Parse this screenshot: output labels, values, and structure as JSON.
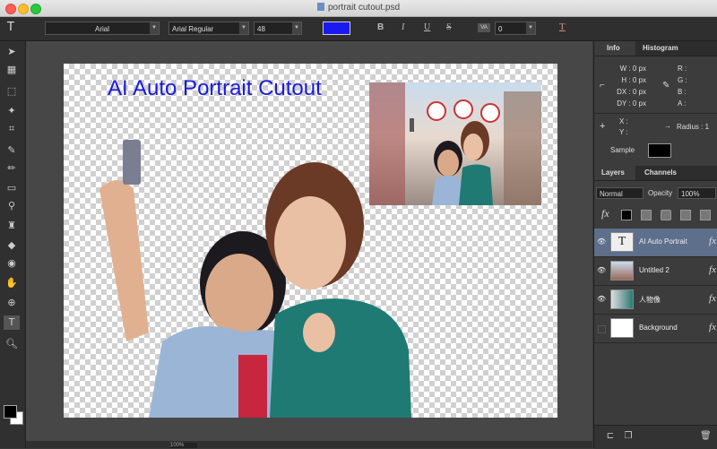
{
  "window": {
    "title": "portrait cutout.psd"
  },
  "options_bar": {
    "font_family": "Arial",
    "font_style": "Arial Regular",
    "font_size": "48",
    "color_hex": "#1a1af0",
    "bold": "B",
    "italic": "I",
    "underline": "U",
    "strike": "S",
    "kerning_label": "VA",
    "kerning_value": "0",
    "warp_label": "T"
  },
  "canvas": {
    "title_text": "AI Auto Portrait Cutout",
    "title_color": "#1a1ad8"
  },
  "info_panel": {
    "tabs": [
      "Info",
      "Histogram"
    ],
    "w": "W :  0 px",
    "h": "H :  0 px",
    "dx": "DX :  0 px",
    "dy": "DY :  0 px",
    "r": "R :",
    "g": "G :",
    "b": "B :",
    "a": "A :",
    "x": "X :",
    "y": "Y :",
    "radius": "Radius :  1",
    "sample": "Sample"
  },
  "layers_panel": {
    "tabs": [
      "Layers",
      "Channels"
    ],
    "blend_mode": "Normal",
    "opacity_label": "Opacity",
    "opacity_value": "100%",
    "fx_label": "fx",
    "layers": [
      {
        "name": "AI Auto Portrait",
        "selected": true,
        "visible": true,
        "fx": "fx"
      },
      {
        "name": "Untitled 2",
        "selected": false,
        "visible": true,
        "fx": "fx"
      },
      {
        "name": "人物像",
        "selected": false,
        "visible": true,
        "fx": "fx"
      },
      {
        "name": "Background",
        "selected": false,
        "visible": false,
        "fx": "fx"
      }
    ]
  },
  "status": {
    "zoom": "100%"
  }
}
